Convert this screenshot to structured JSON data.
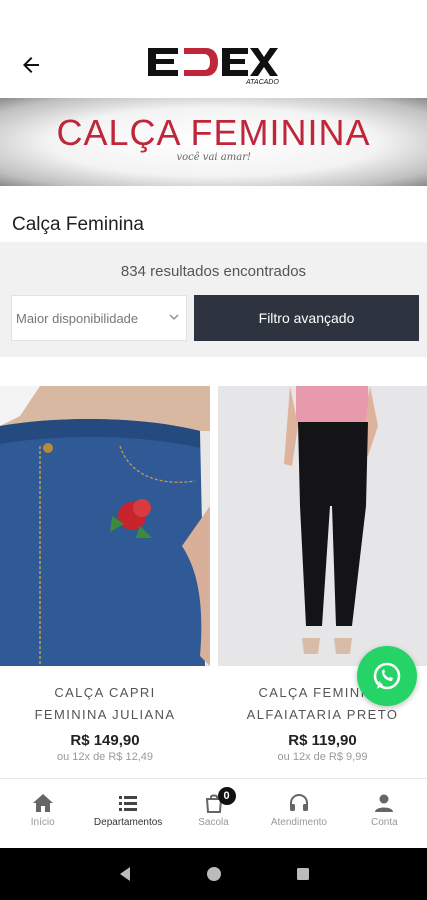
{
  "header": {
    "logo_letters": "EDEX",
    "logo_sub": "ATACADO"
  },
  "banner": {
    "title": "CALÇA FEMININA",
    "tagline": "você vai amar!"
  },
  "page": {
    "title": "Calça Feminina"
  },
  "filters": {
    "results_count": "834 resultados encontrados",
    "sort_selected": "Maior disponibilidade",
    "advanced_filter_label": "Filtro avançado"
  },
  "products": [
    {
      "name": "CALÇA CAPRI\nFEMININA JULIANA",
      "price": "R$ 149,90",
      "installment": "ou 12x de R$ 12,49"
    },
    {
      "name": "CALÇA FEMININA\nALFAIATARIA PRETO",
      "price": "R$ 119,90",
      "installment": "ou 12x de R$ 9,99"
    }
  ],
  "bottom_nav": {
    "items": [
      {
        "label": "Início",
        "icon": "home-icon"
      },
      {
        "label": "Departamentos",
        "icon": "menu-icon"
      },
      {
        "label": "Sacola",
        "icon": "bag-icon",
        "badge": "0"
      },
      {
        "label": "Atendimento",
        "icon": "headset-icon"
      },
      {
        "label": "Conta",
        "icon": "person-icon"
      }
    ],
    "active_index": 1
  },
  "colors": {
    "brand_red": "#c0263a",
    "button_dark": "#2e3340",
    "whatsapp_green": "#25d366"
  }
}
